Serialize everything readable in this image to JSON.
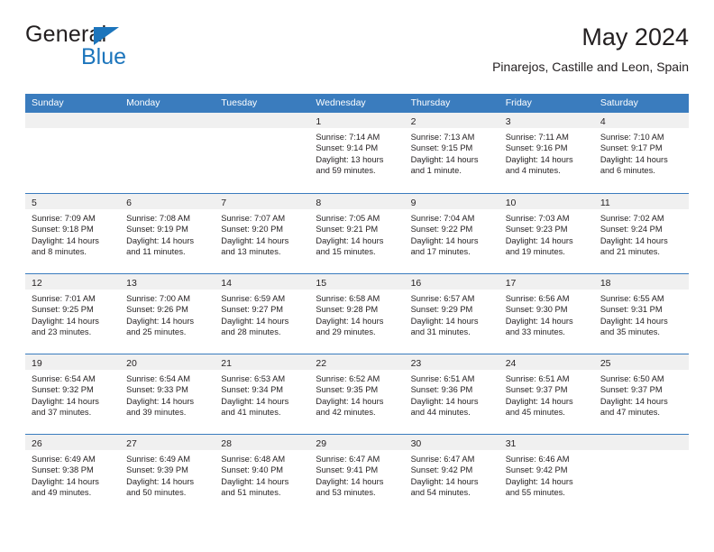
{
  "brand": {
    "name_top": "General",
    "name_bottom": "Blue",
    "accent_color": "#1c75bc"
  },
  "header": {
    "title": "May 2024",
    "subtitle": "Pinarejos, Castille and Leon, Spain"
  },
  "theme": {
    "header_bar_color": "#3a7cbe",
    "day_band_color": "#f0f0f0",
    "text_color": "#231f20"
  },
  "weekdays": [
    "Sunday",
    "Monday",
    "Tuesday",
    "Wednesday",
    "Thursday",
    "Friday",
    "Saturday"
  ],
  "weeks": [
    [
      {
        "day": "",
        "empty": true
      },
      {
        "day": "",
        "empty": true
      },
      {
        "day": "",
        "empty": true
      },
      {
        "day": "1",
        "sunrise": "Sunrise: 7:14 AM",
        "sunset": "Sunset: 9:14 PM",
        "daylight": "Daylight: 13 hours and 59 minutes."
      },
      {
        "day": "2",
        "sunrise": "Sunrise: 7:13 AM",
        "sunset": "Sunset: 9:15 PM",
        "daylight": "Daylight: 14 hours and 1 minute."
      },
      {
        "day": "3",
        "sunrise": "Sunrise: 7:11 AM",
        "sunset": "Sunset: 9:16 PM",
        "daylight": "Daylight: 14 hours and 4 minutes."
      },
      {
        "day": "4",
        "sunrise": "Sunrise: 7:10 AM",
        "sunset": "Sunset: 9:17 PM",
        "daylight": "Daylight: 14 hours and 6 minutes."
      }
    ],
    [
      {
        "day": "5",
        "sunrise": "Sunrise: 7:09 AM",
        "sunset": "Sunset: 9:18 PM",
        "daylight": "Daylight: 14 hours and 8 minutes."
      },
      {
        "day": "6",
        "sunrise": "Sunrise: 7:08 AM",
        "sunset": "Sunset: 9:19 PM",
        "daylight": "Daylight: 14 hours and 11 minutes."
      },
      {
        "day": "7",
        "sunrise": "Sunrise: 7:07 AM",
        "sunset": "Sunset: 9:20 PM",
        "daylight": "Daylight: 14 hours and 13 minutes."
      },
      {
        "day": "8",
        "sunrise": "Sunrise: 7:05 AM",
        "sunset": "Sunset: 9:21 PM",
        "daylight": "Daylight: 14 hours and 15 minutes."
      },
      {
        "day": "9",
        "sunrise": "Sunrise: 7:04 AM",
        "sunset": "Sunset: 9:22 PM",
        "daylight": "Daylight: 14 hours and 17 minutes."
      },
      {
        "day": "10",
        "sunrise": "Sunrise: 7:03 AM",
        "sunset": "Sunset: 9:23 PM",
        "daylight": "Daylight: 14 hours and 19 minutes."
      },
      {
        "day": "11",
        "sunrise": "Sunrise: 7:02 AM",
        "sunset": "Sunset: 9:24 PM",
        "daylight": "Daylight: 14 hours and 21 minutes."
      }
    ],
    [
      {
        "day": "12",
        "sunrise": "Sunrise: 7:01 AM",
        "sunset": "Sunset: 9:25 PM",
        "daylight": "Daylight: 14 hours and 23 minutes."
      },
      {
        "day": "13",
        "sunrise": "Sunrise: 7:00 AM",
        "sunset": "Sunset: 9:26 PM",
        "daylight": "Daylight: 14 hours and 25 minutes."
      },
      {
        "day": "14",
        "sunrise": "Sunrise: 6:59 AM",
        "sunset": "Sunset: 9:27 PM",
        "daylight": "Daylight: 14 hours and 28 minutes."
      },
      {
        "day": "15",
        "sunrise": "Sunrise: 6:58 AM",
        "sunset": "Sunset: 9:28 PM",
        "daylight": "Daylight: 14 hours and 29 minutes."
      },
      {
        "day": "16",
        "sunrise": "Sunrise: 6:57 AM",
        "sunset": "Sunset: 9:29 PM",
        "daylight": "Daylight: 14 hours and 31 minutes."
      },
      {
        "day": "17",
        "sunrise": "Sunrise: 6:56 AM",
        "sunset": "Sunset: 9:30 PM",
        "daylight": "Daylight: 14 hours and 33 minutes."
      },
      {
        "day": "18",
        "sunrise": "Sunrise: 6:55 AM",
        "sunset": "Sunset: 9:31 PM",
        "daylight": "Daylight: 14 hours and 35 minutes."
      }
    ],
    [
      {
        "day": "19",
        "sunrise": "Sunrise: 6:54 AM",
        "sunset": "Sunset: 9:32 PM",
        "daylight": "Daylight: 14 hours and 37 minutes."
      },
      {
        "day": "20",
        "sunrise": "Sunrise: 6:54 AM",
        "sunset": "Sunset: 9:33 PM",
        "daylight": "Daylight: 14 hours and 39 minutes."
      },
      {
        "day": "21",
        "sunrise": "Sunrise: 6:53 AM",
        "sunset": "Sunset: 9:34 PM",
        "daylight": "Daylight: 14 hours and 41 minutes."
      },
      {
        "day": "22",
        "sunrise": "Sunrise: 6:52 AM",
        "sunset": "Sunset: 9:35 PM",
        "daylight": "Daylight: 14 hours and 42 minutes."
      },
      {
        "day": "23",
        "sunrise": "Sunrise: 6:51 AM",
        "sunset": "Sunset: 9:36 PM",
        "daylight": "Daylight: 14 hours and 44 minutes."
      },
      {
        "day": "24",
        "sunrise": "Sunrise: 6:51 AM",
        "sunset": "Sunset: 9:37 PM",
        "daylight": "Daylight: 14 hours and 45 minutes."
      },
      {
        "day": "25",
        "sunrise": "Sunrise: 6:50 AM",
        "sunset": "Sunset: 9:37 PM",
        "daylight": "Daylight: 14 hours and 47 minutes."
      }
    ],
    [
      {
        "day": "26",
        "sunrise": "Sunrise: 6:49 AM",
        "sunset": "Sunset: 9:38 PM",
        "daylight": "Daylight: 14 hours and 49 minutes."
      },
      {
        "day": "27",
        "sunrise": "Sunrise: 6:49 AM",
        "sunset": "Sunset: 9:39 PM",
        "daylight": "Daylight: 14 hours and 50 minutes."
      },
      {
        "day": "28",
        "sunrise": "Sunrise: 6:48 AM",
        "sunset": "Sunset: 9:40 PM",
        "daylight": "Daylight: 14 hours and 51 minutes."
      },
      {
        "day": "29",
        "sunrise": "Sunrise: 6:47 AM",
        "sunset": "Sunset: 9:41 PM",
        "daylight": "Daylight: 14 hours and 53 minutes."
      },
      {
        "day": "30",
        "sunrise": "Sunrise: 6:47 AM",
        "sunset": "Sunset: 9:42 PM",
        "daylight": "Daylight: 14 hours and 54 minutes."
      },
      {
        "day": "31",
        "sunrise": "Sunrise: 6:46 AM",
        "sunset": "Sunset: 9:42 PM",
        "daylight": "Daylight: 14 hours and 55 minutes."
      },
      {
        "day": "",
        "empty": true
      }
    ]
  ]
}
